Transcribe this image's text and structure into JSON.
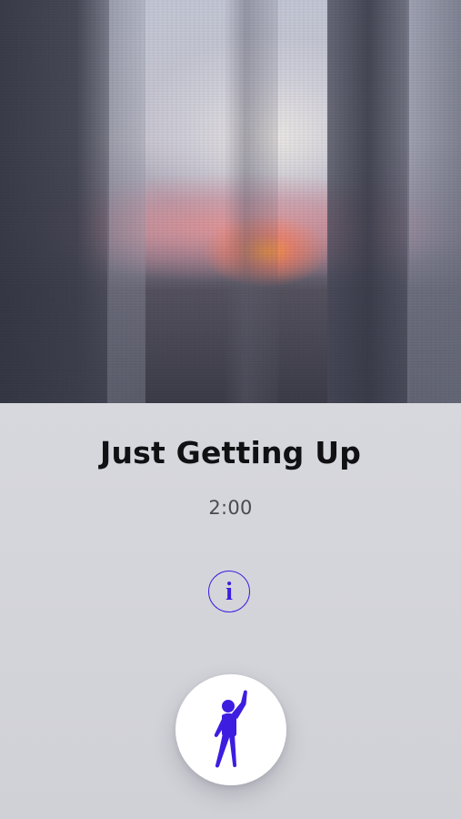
{
  "exercise": {
    "title": "Just Getting Up",
    "duration": "2:00"
  },
  "info_button": {
    "glyph": "i",
    "icon": "info-icon"
  },
  "start_button": {
    "icon": "person-stretching-icon"
  },
  "colors": {
    "accent": "#3d1ee0",
    "background": "#d9dadf",
    "title": "#111114",
    "duration": "#4a4a52"
  }
}
